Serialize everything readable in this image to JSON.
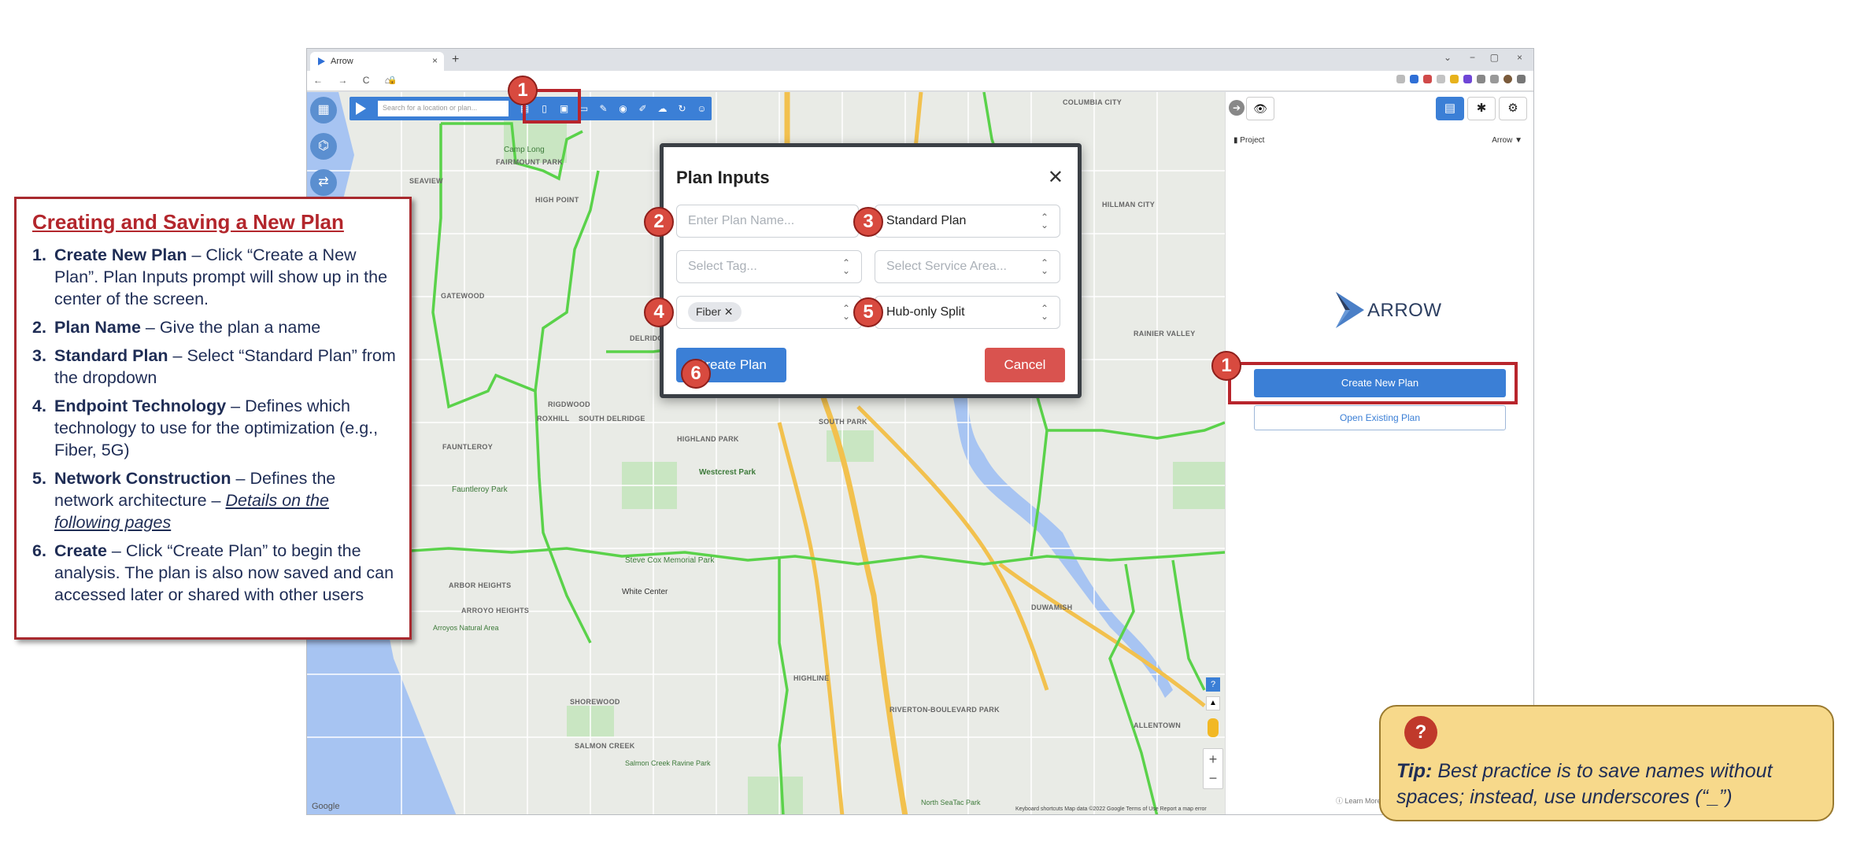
{
  "browser": {
    "tab_title": "Arrow",
    "new_tab": "+",
    "close_tab": "×",
    "window_controls": [
      "⌄",
      "−",
      "▢",
      "×"
    ],
    "nav": [
      "←",
      "→",
      "C",
      "⌂"
    ],
    "address": "🔒"
  },
  "toolbar": {
    "search_placeholder": "Search for a location or plan..."
  },
  "map": {
    "labels": [
      "COLUMBIA CITY",
      "SEAVIEW",
      "HIGH POINT",
      "FAIRMOUNT PARK",
      "GATEWOOD",
      "DELRIDGE",
      "RIGDWOOD",
      "SOUTH DELRIDGE",
      "ROXHILL",
      "FAUNTLEROY",
      "HIGHLAND PARK",
      "SOUTH PARK",
      "ARBOR HEIGHTS",
      "ARROYO HEIGHTS",
      "SHOREWOOD",
      "SALMON CREEK",
      "HIGHLINE",
      "RIVERTON-BOULEVARD PARK",
      "DUWAMISH",
      "ALLENTOWN",
      "HILLMAN CITY",
      "RAINIER VALLEY",
      "Westcrest Park",
      "White Center",
      "Steve Cox Memorial Park",
      "Camp Long",
      "Fauntleroy Park",
      "Arroyos Natural Area",
      "Salmon Creek Ravine Park",
      "North SeaTac Park"
    ],
    "google": "Google",
    "attribution": "Keyboard shortcuts   Map data ©2022 Google   Terms of Use   Report a map error",
    "zoom_in": "+",
    "zoom_out": "−"
  },
  "sidebar": {
    "project_label": "Project",
    "project_value": "Arrow",
    "logo_text": "ARROW",
    "create_new_plan": "Create New Plan",
    "open_existing_plan": "Open Existing Plan",
    "learn_more": "Learn More"
  },
  "modal": {
    "title": "Plan Inputs",
    "close": "✕",
    "plan_name_placeholder": "Enter Plan Name...",
    "plan_type": "Standard Plan",
    "tag_placeholder": "Select Tag...",
    "service_area_placeholder": "Select Service Area...",
    "technology_chip": "Fiber",
    "construction": "Hub-only Split",
    "create_plan": "Create Plan",
    "cancel": "Cancel"
  },
  "badges": [
    "1",
    "2",
    "3",
    "4",
    "5",
    "6",
    "1"
  ],
  "instructions": {
    "title": "Creating and Saving a New Plan",
    "steps": [
      {
        "num": "1.",
        "bold": "Create New Plan",
        "text": " – Click “Create a New Plan”. Plan Inputs prompt will show up in the center of the screen."
      },
      {
        "num": "2.",
        "bold": "Plan Name",
        "text": "  – Give the plan a name"
      },
      {
        "num": "3.",
        "bold": "Standard Plan",
        "text": " – Select “Standard Plan” from the dropdown"
      },
      {
        "num": "4.",
        "bold": "Endpoint Technology",
        "text": " – Defines which technology to use for the optimization (e.g., Fiber, 5G)"
      },
      {
        "num": "5.",
        "bold": "Network Construction",
        "text": "  – Defines the network architecture – ",
        "link": "Details on the following pages"
      },
      {
        "num": "6.",
        "bold": "Create",
        "text": " – Click “Create Plan” to begin the analysis. The plan is also now saved and can accessed later or shared with other users"
      }
    ]
  },
  "tip": {
    "icon": "?",
    "label": "Tip:",
    "text": " Best practice is to save names without spaces; instead, use underscores (“_”)"
  },
  "colors": {
    "accent_blue": "#3b7fd6",
    "highlight_red": "#b8252c",
    "tip_yellow": "#f7d98b",
    "route_green": "#5ad24a",
    "highway_yellow": "#f2c14e",
    "water_blue": "#a7c4f2"
  }
}
